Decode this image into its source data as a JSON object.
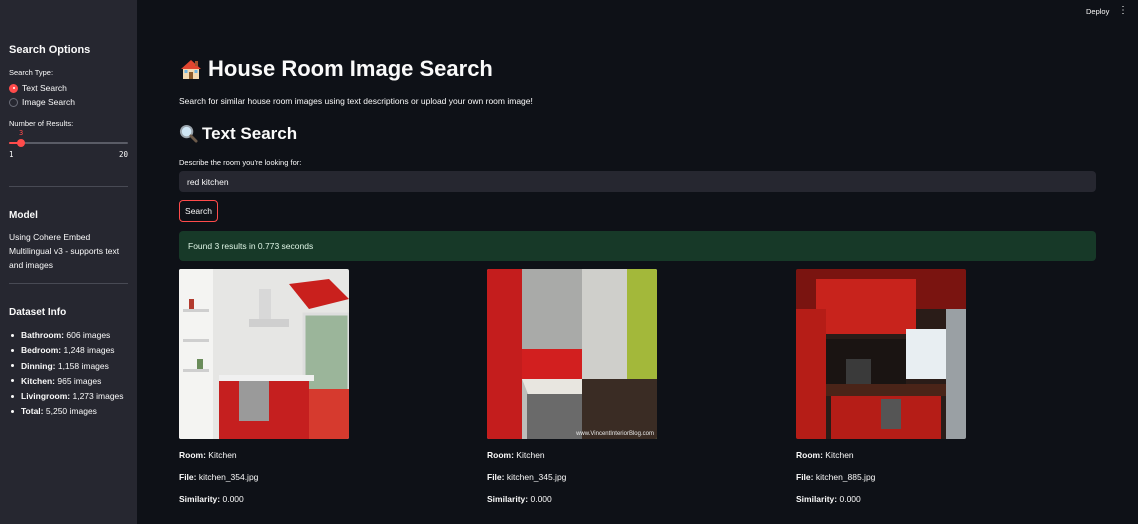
{
  "header": {
    "deploy_label": "Deploy",
    "menu_icon": "more-vert-icon"
  },
  "sidebar": {
    "title": "Search Options",
    "search_type_label": "Search Type:",
    "search_types": [
      {
        "label": "Text Search",
        "selected": true
      },
      {
        "label": "Image Search",
        "selected": false
      }
    ],
    "num_results_label": "Number of Results:",
    "num_results": {
      "value": "3",
      "min": "1",
      "max": "20"
    },
    "model_heading": "Model",
    "model_text": "Using Cohere Embed Multilingual v3 - supports text and images",
    "dataset_heading": "Dataset Info",
    "dataset": [
      {
        "name": "Bathroom:",
        "count": "606 images"
      },
      {
        "name": "Bedroom:",
        "count": "1,248 images"
      },
      {
        "name": "Dinning:",
        "count": "1,158 images"
      },
      {
        "name": "Kitchen:",
        "count": "965 images"
      },
      {
        "name": "Livingroom:",
        "count": "1,273 images"
      },
      {
        "name": "Total:",
        "count": "5,250 images"
      }
    ]
  },
  "main": {
    "title_icon": "house-icon",
    "title": "House Room Image Search",
    "subtitle": "Search for similar house room images using text descriptions or upload your own room image!",
    "section_icon": "magnifier-icon",
    "section_title": "Text Search",
    "input_label": "Describe the room you're looking for:",
    "input_value": "red kitchen",
    "search_button": "Search",
    "result_message": "Found 3 results in 0.773 seconds",
    "results": [
      {
        "room_label": "Room:",
        "room": "Kitchen",
        "file_label": "File:",
        "file": "kitchen_354.jpg",
        "similarity_label": "Similarity:",
        "similarity": "0.000"
      },
      {
        "room_label": "Room:",
        "room": "Kitchen",
        "file_label": "File:",
        "file": "kitchen_345.jpg",
        "similarity_label": "Similarity:",
        "similarity": "0.000",
        "watermark": "www.VincentInteriorBlog.com"
      },
      {
        "room_label": "Room:",
        "room": "Kitchen",
        "file_label": "File:",
        "file": "kitchen_885.jpg",
        "similarity_label": "Similarity:",
        "similarity": "0.000"
      }
    ]
  },
  "colors": {
    "background": "#0e1117",
    "sidebar": "#262730",
    "accent": "#ff4b4b",
    "success_bg": "#173928"
  }
}
